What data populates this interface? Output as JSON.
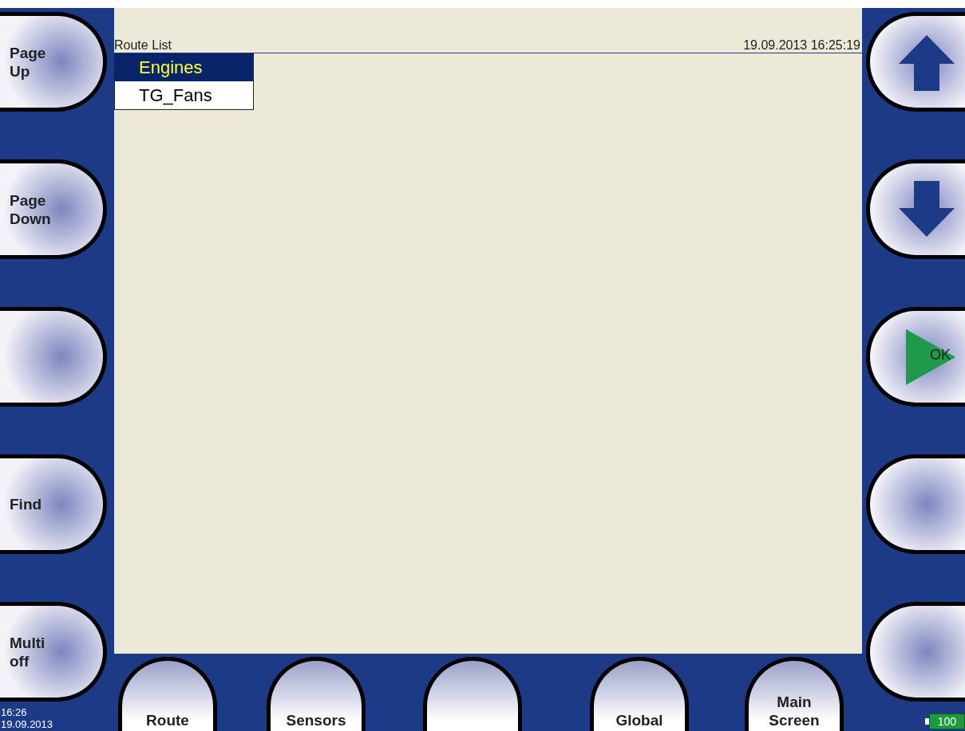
{
  "header": {
    "title": "Route List",
    "datetime": "19.09.2013 16:25:19"
  },
  "routes": [
    {
      "label": "Engines",
      "selected": true
    },
    {
      "label": "TG_Fans",
      "selected": false
    }
  ],
  "left_buttons": [
    {
      "kind": "text",
      "lines": [
        "Page",
        "Up"
      ]
    },
    {
      "kind": "text",
      "lines": [
        "Page",
        "Down"
      ]
    },
    {
      "kind": "blank"
    },
    {
      "kind": "text",
      "lines": [
        "Find"
      ]
    },
    {
      "kind": "text",
      "lines": [
        "Multi",
        "off"
      ]
    }
  ],
  "right_buttons": [
    {
      "kind": "up_arrow"
    },
    {
      "kind": "down_arrow"
    },
    {
      "kind": "ok",
      "label": "OK"
    },
    {
      "kind": "blank"
    },
    {
      "kind": "blank"
    }
  ],
  "bottom_buttons": [
    {
      "kind": "text",
      "lines": [
        "Route"
      ]
    },
    {
      "kind": "text",
      "lines": [
        "Sensors"
      ]
    },
    {
      "kind": "blank"
    },
    {
      "kind": "text",
      "lines": [
        "Global"
      ]
    },
    {
      "kind": "text",
      "lines": [
        "Main",
        "Screen"
      ]
    }
  ],
  "status": {
    "time": "16:26",
    "date": "19.09.2013",
    "battery": "100"
  }
}
